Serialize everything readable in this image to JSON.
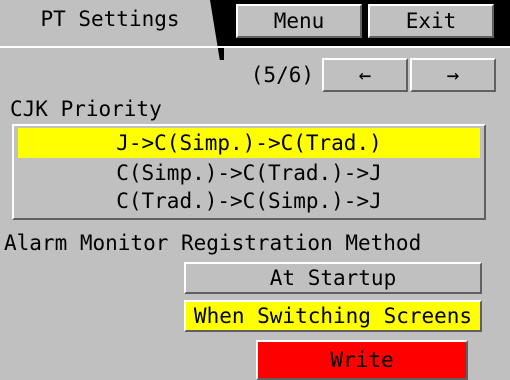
{
  "header": {
    "title": "PT Settings",
    "menu_label": "Menu",
    "exit_label": "Exit"
  },
  "pager": {
    "indicator": "(5/6)",
    "prev_label": "←",
    "next_label": "→"
  },
  "cjk_priority": {
    "label": "CJK Priority",
    "options": [
      "J->C(Simp.)->C(Trad.)",
      "C(Simp.)->C(Trad.)->J",
      "C(Trad.)->C(Simp.)->J"
    ],
    "selected_index": 0
  },
  "alarm_monitor": {
    "label": "Alarm Monitor Registration Method",
    "options": [
      "At Startup",
      "When Switching Screens"
    ],
    "selected_index": 1
  },
  "write_label": "Write",
  "colors": {
    "panel": "#c0c0c0",
    "selected": "#ffff00",
    "write": "#ff0000",
    "bar": "#000000"
  }
}
